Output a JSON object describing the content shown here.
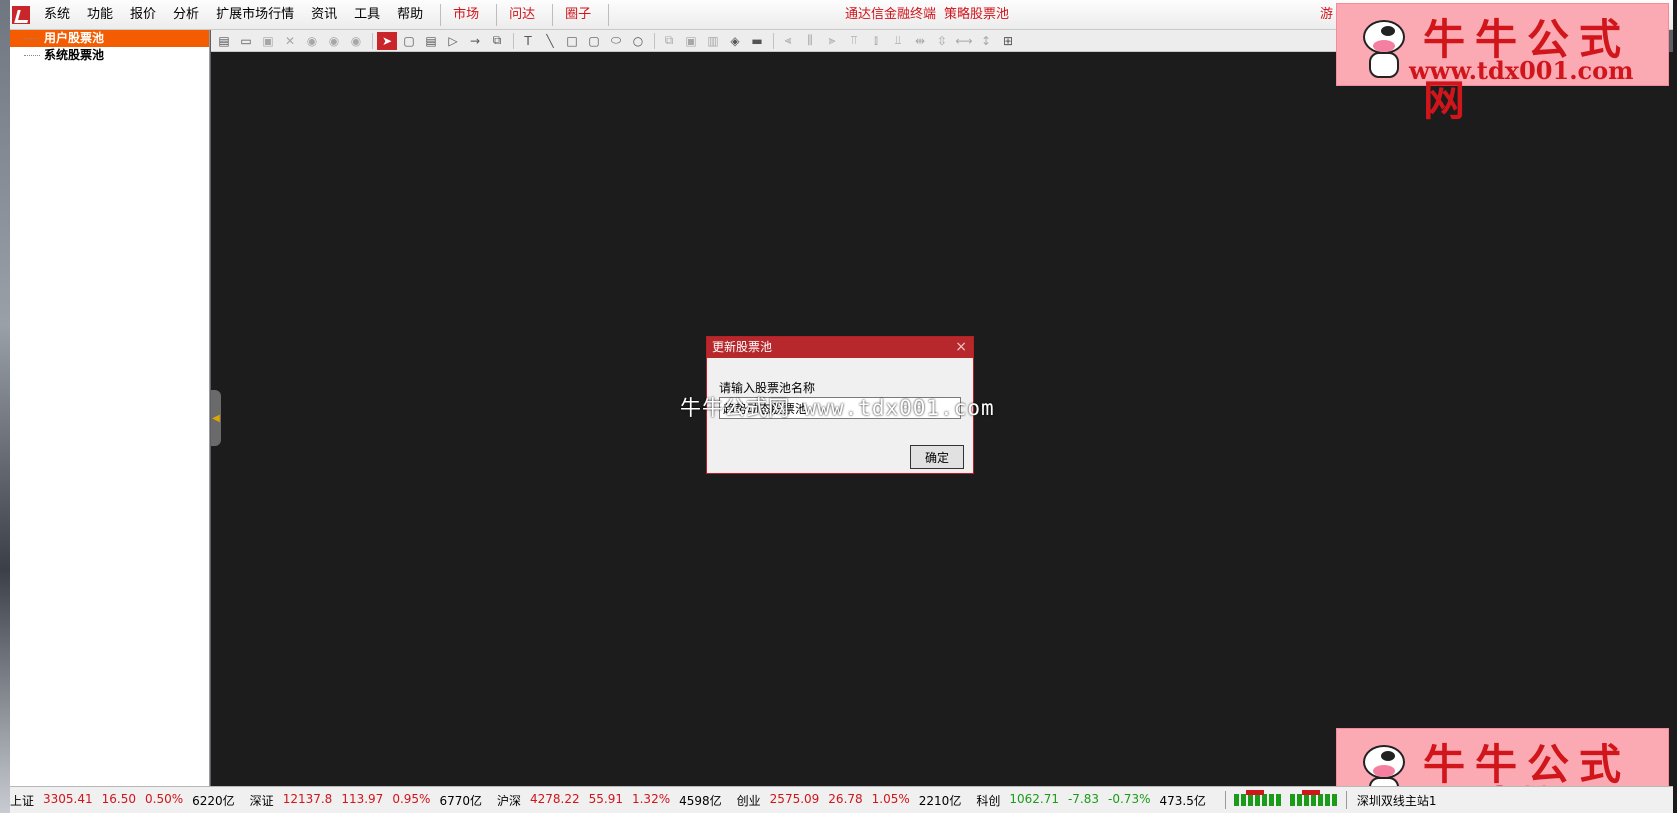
{
  "menubar": {
    "items": [
      "系统",
      "功能",
      "报价",
      "分析",
      "扩展市场行情",
      "资讯",
      "工具",
      "帮助"
    ],
    "tabs": [
      "市场",
      "问达",
      "圈子"
    ],
    "center_title": [
      "通达信金融终端",
      "策略股票池"
    ],
    "right_label": "游"
  },
  "tree": {
    "items": [
      "用户股票池",
      "系统股票池"
    ]
  },
  "dialog": {
    "title": "更新股票池",
    "close": "×",
    "label": "请输入股票池名称",
    "input_value": "趋势动态股票池",
    "ok_label": "确定"
  },
  "watermark_center": "牛牛公式网 www.tdx001.com",
  "statusbar": {
    "indices": [
      {
        "name": "上证",
        "value": "3305.41",
        "change": "16.50",
        "pct": "0.50%",
        "turnover": "6220亿",
        "dir": "up"
      },
      {
        "name": "深证",
        "value": "12137.8",
        "change": "113.97",
        "pct": "0.95%",
        "turnover": "6770亿",
        "dir": "up"
      },
      {
        "name": "沪深",
        "value": "4278.22",
        "change": "55.91",
        "pct": "1.32%",
        "turnover": "4598亿",
        "dir": "up"
      },
      {
        "name": "创业",
        "value": "2575.09",
        "change": "26.78",
        "pct": "1.05%",
        "turnover": "2210亿",
        "dir": "up"
      },
      {
        "name": "科创",
        "value": "1062.71",
        "change": "-7.83",
        "pct": "-0.73%",
        "turnover": "473.5亿",
        "dir": "down"
      }
    ],
    "server": "深圳双线主站1"
  },
  "brand": {
    "title": "牛牛公式网",
    "url": "www.tdx001.com"
  },
  "colors": {
    "accent_red": "#d0151b",
    "selected_orange": "#f35c00",
    "dialog_title_red": "#b7282c",
    "canvas_dark": "#1c1c1c",
    "brand_pink": "#fba9b2"
  }
}
